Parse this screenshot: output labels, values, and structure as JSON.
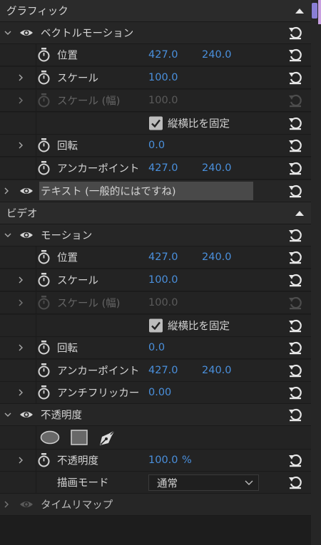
{
  "sections": {
    "graphics": "グラフィック",
    "video": "ビデオ"
  },
  "vector_motion": {
    "title": "ベクトルモーション",
    "position_label": "位置",
    "position_x": "427.0",
    "position_y": "240.0",
    "scale_label": "スケール",
    "scale_value": "100.0",
    "scale_width_label": "スケール (幅)",
    "scale_width_value": "100.0",
    "uniform_label": "縦横比を固定",
    "rotation_label": "回転",
    "rotation_value": "0.0",
    "anchor_label": "アンカーポイント",
    "anchor_x": "427.0",
    "anchor_y": "240.0"
  },
  "text_layer": {
    "label": "テキスト (一般的にはですね)"
  },
  "motion": {
    "title": "モーション",
    "position_label": "位置",
    "position_x": "427.0",
    "position_y": "240.0",
    "scale_label": "スケール",
    "scale_value": "100.0",
    "scale_width_label": "スケール (幅)",
    "scale_width_value": "100.0",
    "uniform_label": "縦横比を固定",
    "rotation_label": "回転",
    "rotation_value": "0.0",
    "anchor_label": "アンカーポイント",
    "anchor_x": "427.0",
    "anchor_y": "240.0",
    "antiflicker_label": "アンチフリッカー",
    "antiflicker_value": "0.00"
  },
  "opacity": {
    "title": "不透明度",
    "opacity_label": "不透明度",
    "opacity_value": "100.0",
    "opacity_unit": "%",
    "blend_label": "描画モード",
    "blend_value": "通常"
  },
  "time_remap": {
    "title": "タイムリマップ"
  },
  "colors": {
    "accent_blue": "#4a90dd",
    "panel_bg": "#232323"
  },
  "icons": [
    "chevron-down-icon",
    "chevron-right-icon",
    "eye-icon",
    "stopwatch-icon",
    "reset-icon",
    "collapse-up-icon",
    "checkbox-checked-icon",
    "ellipse-mask-icon",
    "rectangle-mask-icon",
    "pen-mask-icon",
    "dropdown-arrow-icon"
  ]
}
